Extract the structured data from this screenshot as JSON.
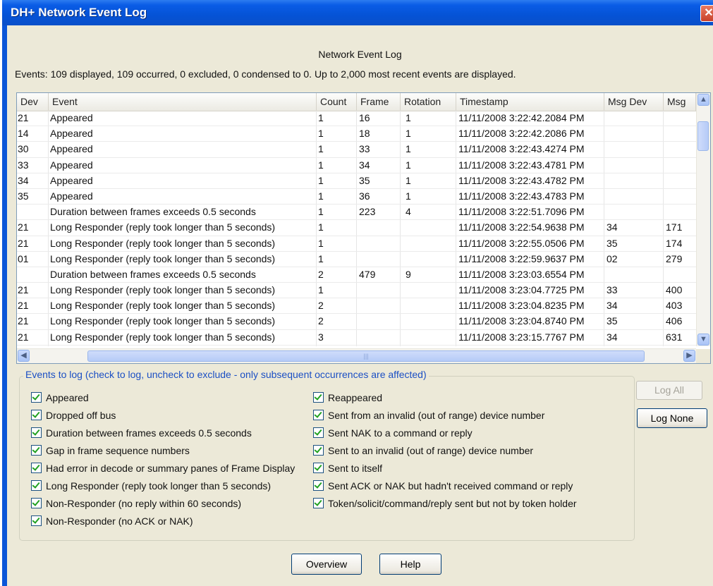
{
  "window": {
    "title": "DH+ Network Event Log",
    "close_glyph": "✕"
  },
  "heading": "Network Event Log",
  "summary": "Events: 109 displayed, 109 occurred, 0 excluded, 0 condensed to 0.  Up to 2,000 most recent events are displayed.",
  "table": {
    "columns": [
      "Dev",
      "Event",
      "Count",
      "Frame",
      "Rotation",
      "Timestamp",
      "Msg Dev",
      "Msg"
    ],
    "rows": [
      {
        "dev": "21",
        "event": "Appeared",
        "count": "1",
        "frame": "16",
        "rotation": "1",
        "timestamp": "11/11/2008 3:22:42.2084 PM",
        "msg_dev": "",
        "msg": ""
      },
      {
        "dev": "14",
        "event": "Appeared",
        "count": "1",
        "frame": "18",
        "rotation": "1",
        "timestamp": "11/11/2008 3:22:42.2086 PM",
        "msg_dev": "",
        "msg": ""
      },
      {
        "dev": "30",
        "event": "Appeared",
        "count": "1",
        "frame": "33",
        "rotation": "1",
        "timestamp": "11/11/2008 3:22:43.4274 PM",
        "msg_dev": "",
        "msg": ""
      },
      {
        "dev": "33",
        "event": "Appeared",
        "count": "1",
        "frame": "34",
        "rotation": "1",
        "timestamp": "11/11/2008 3:22:43.4781 PM",
        "msg_dev": "",
        "msg": ""
      },
      {
        "dev": "34",
        "event": "Appeared",
        "count": "1",
        "frame": "35",
        "rotation": "1",
        "timestamp": "11/11/2008 3:22:43.4782 PM",
        "msg_dev": "",
        "msg": ""
      },
      {
        "dev": "35",
        "event": "Appeared",
        "count": "1",
        "frame": "36",
        "rotation": "1",
        "timestamp": "11/11/2008 3:22:43.4783 PM",
        "msg_dev": "",
        "msg": ""
      },
      {
        "dev": "",
        "event": "Duration between frames exceeds 0.5 seconds",
        "count": "1",
        "frame": "223",
        "rotation": "4",
        "timestamp": "11/11/2008 3:22:51.7096 PM",
        "msg_dev": "",
        "msg": ""
      },
      {
        "dev": "21",
        "event": "Long Responder (reply took longer than 5 seconds)",
        "count": "1",
        "frame": "",
        "rotation": "",
        "timestamp": "11/11/2008 3:22:54.9638 PM",
        "msg_dev": "34",
        "msg": "171"
      },
      {
        "dev": "21",
        "event": "Long Responder (reply took longer than 5 seconds)",
        "count": "1",
        "frame": "",
        "rotation": "",
        "timestamp": "11/11/2008 3:22:55.0506 PM",
        "msg_dev": "35",
        "msg": "174"
      },
      {
        "dev": "01",
        "event": "Long Responder (reply took longer than 5 seconds)",
        "count": "1",
        "frame": "",
        "rotation": "",
        "timestamp": "11/11/2008 3:22:59.9637 PM",
        "msg_dev": "02",
        "msg": "279"
      },
      {
        "dev": "",
        "event": "Duration between frames exceeds 0.5 seconds",
        "count": "2",
        "frame": "479",
        "rotation": "9",
        "timestamp": "11/11/2008 3:23:03.6554 PM",
        "msg_dev": "",
        "msg": ""
      },
      {
        "dev": "21",
        "event": "Long Responder (reply took longer than 5 seconds)",
        "count": "1",
        "frame": "",
        "rotation": "",
        "timestamp": "11/11/2008 3:23:04.7725 PM",
        "msg_dev": "33",
        "msg": "400"
      },
      {
        "dev": "21",
        "event": "Long Responder (reply took longer than 5 seconds)",
        "count": "2",
        "frame": "",
        "rotation": "",
        "timestamp": "11/11/2008 3:23:04.8235 PM",
        "msg_dev": "34",
        "msg": "403"
      },
      {
        "dev": "21",
        "event": "Long Responder (reply took longer than 5 seconds)",
        "count": "2",
        "frame": "",
        "rotation": "",
        "timestamp": "11/11/2008 3:23:04.8740 PM",
        "msg_dev": "35",
        "msg": "406"
      },
      {
        "dev": "21",
        "event": "Long Responder (reply took longer than 5 seconds)",
        "count": "3",
        "frame": "",
        "rotation": "",
        "timestamp": "11/11/2008 3:23:15.7767 PM",
        "msg_dev": "34",
        "msg": "631"
      }
    ]
  },
  "scroll": {
    "up": "▲",
    "down": "▼",
    "left": "◀",
    "right": "▶",
    "grip": "|||"
  },
  "events_group": {
    "legend": "Events to log (check to log, uncheck to exclude - only subsequent occurrences are affected)",
    "left": [
      {
        "label": "Appeared",
        "checked": true
      },
      {
        "label": "Dropped off bus",
        "checked": true
      },
      {
        "label": "Duration between frames exceeds 0.5 seconds",
        "checked": true
      },
      {
        "label": "Gap in frame sequence numbers",
        "checked": true
      },
      {
        "label": "Had error in decode or summary panes of Frame Display",
        "checked": true
      },
      {
        "label": "Long Responder (reply took longer than 5 seconds)",
        "checked": true
      },
      {
        "label": "Non-Responder (no reply within 60 seconds)",
        "checked": true
      },
      {
        "label": "Non-Responder (no ACK or NAK)",
        "checked": true
      }
    ],
    "right": [
      {
        "label": "Reappeared",
        "checked": true
      },
      {
        "label": "Sent from an invalid (out of range) device number",
        "checked": true
      },
      {
        "label": "Sent NAK to a command or reply",
        "checked": true
      },
      {
        "label": "Sent to an invalid (out of range) device number",
        "checked": true
      },
      {
        "label": "Sent to itself",
        "checked": true
      },
      {
        "label": "Sent ACK or NAK but hadn't received command or reply",
        "checked": true
      },
      {
        "label": "Token/solicit/command/reply sent but not by token holder",
        "checked": true
      }
    ]
  },
  "buttons": {
    "log_all": "Log All",
    "log_none": "Log None",
    "overview": "Overview",
    "help": "Help"
  }
}
